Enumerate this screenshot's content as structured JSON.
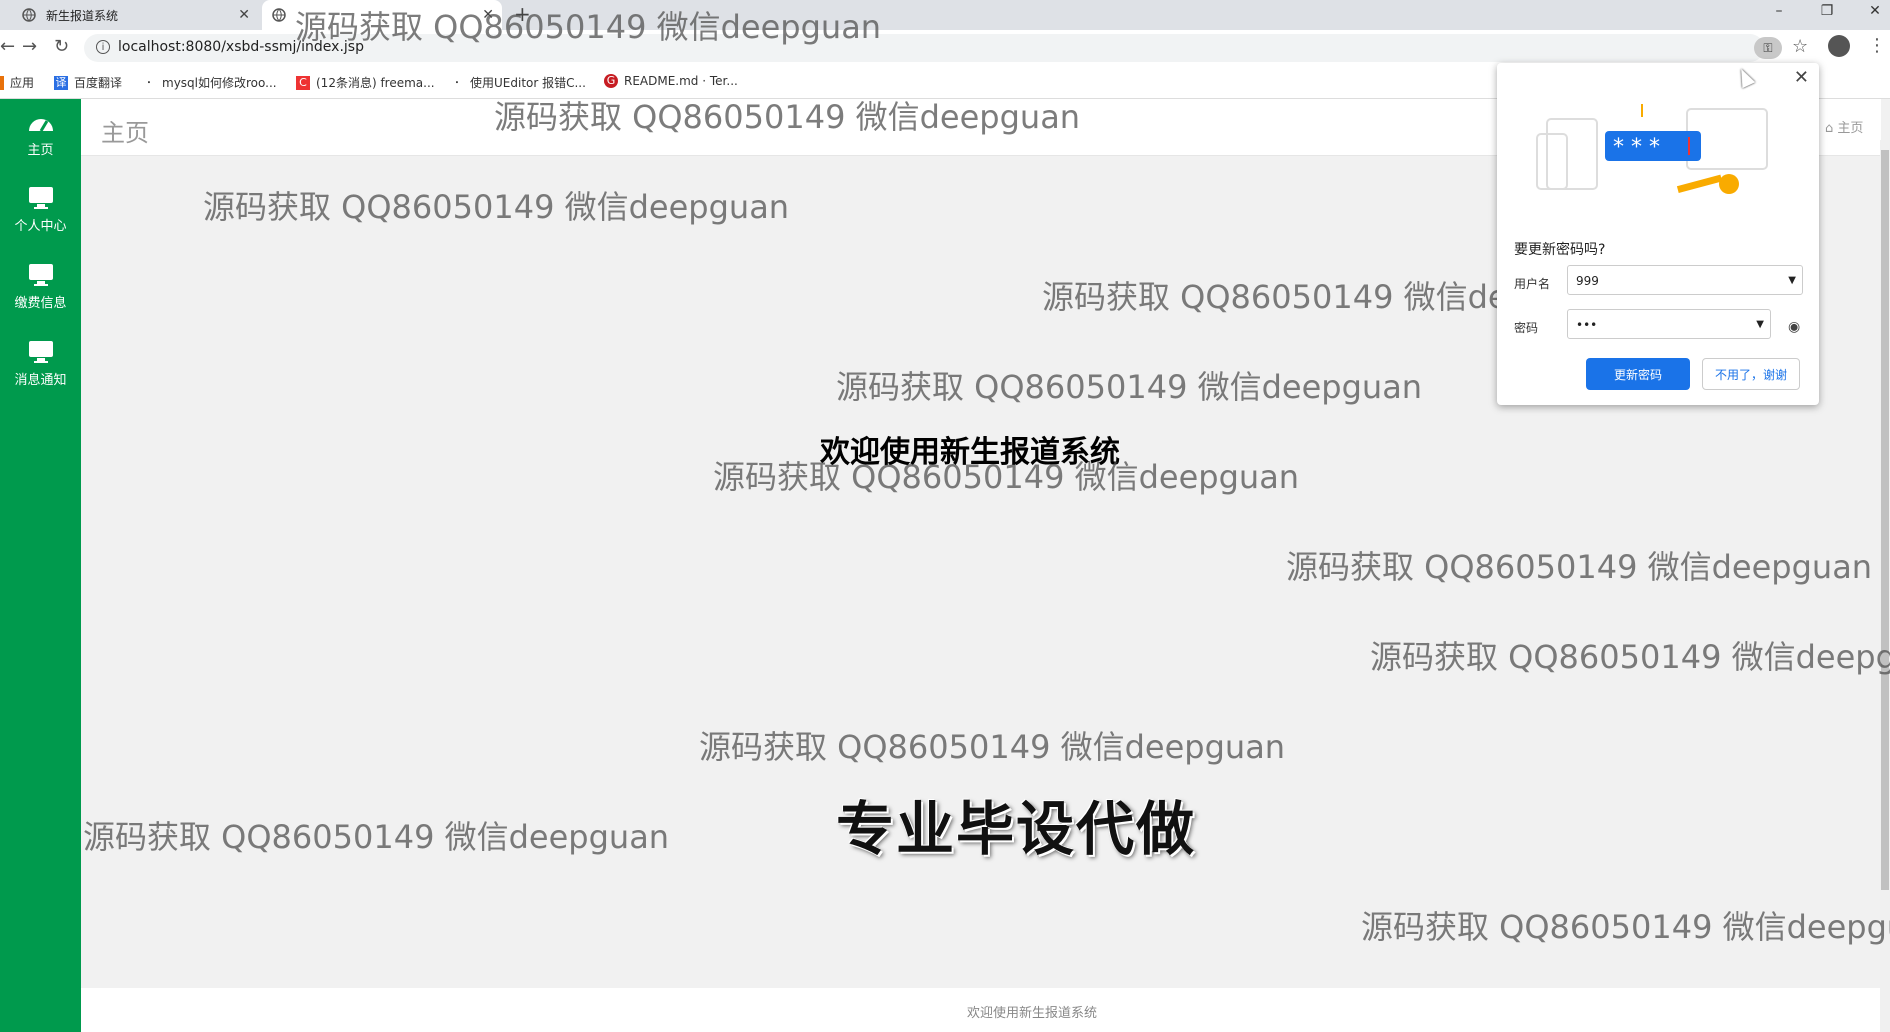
{
  "browser": {
    "tabs": [
      {
        "title": "新生报道系统",
        "active": false
      },
      {
        "title": "",
        "active": true
      }
    ],
    "url": "localhost:8080/xsbd-ssmj/index.jsp",
    "bookmarks": [
      "应用",
      "百度翻译",
      "mysql如何修改roo...",
      "(12条消息) freema...",
      "使用UEditor 报错C...",
      "README.md · Ter..."
    ],
    "window_controls": [
      "–",
      "❐",
      "✕"
    ]
  },
  "sidebar": {
    "items": [
      {
        "label": "主页",
        "icon": "dashboard-icon"
      },
      {
        "label": "个人中心",
        "icon": "monitor-icon"
      },
      {
        "label": "缴费信息",
        "icon": "monitor-icon"
      },
      {
        "label": "消息通知",
        "icon": "monitor-icon"
      }
    ]
  },
  "header": {
    "title": "主页",
    "breadcrumb": "主页"
  },
  "main": {
    "welcome": "欢迎使用新生报道系统",
    "banner": "专业毕设代做"
  },
  "footer": {
    "text": "欢迎使用新生报道系统"
  },
  "watermark": {
    "text": "源码获取 QQ86050149 微信deepguan"
  },
  "password_popup": {
    "title": "要更新密码吗?",
    "username_label": "用户名",
    "username_value": "999",
    "password_label": "密码",
    "password_value": "•••",
    "update_button": "更新密码",
    "dismiss_button": "不用了，谢谢",
    "close": "✕"
  },
  "colors": {
    "sidebar": "#009a4d",
    "primary_button": "#1a73e8"
  }
}
